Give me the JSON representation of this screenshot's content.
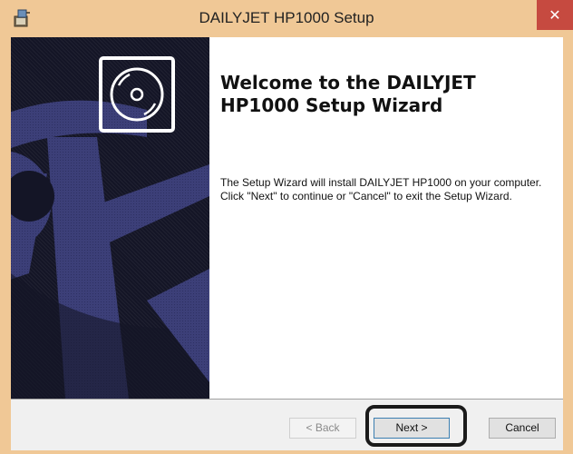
{
  "window": {
    "title": "DAILYJET HP1000 Setup",
    "close_glyph": "✕",
    "accent_color": "#f0c896",
    "close_color": "#c64a40"
  },
  "wizard": {
    "heading": "Welcome to the DAILYJET HP1000 Setup Wizard",
    "description": "The Setup Wizard will install DAILYJET HP1000 on your computer.  Click \"Next\" to continue or \"Cancel\" to exit the Setup Wizard.",
    "banner_icon": "disc-icon"
  },
  "buttons": {
    "back_label": "< Back",
    "next_label": "Next >",
    "cancel_label": "Cancel"
  }
}
